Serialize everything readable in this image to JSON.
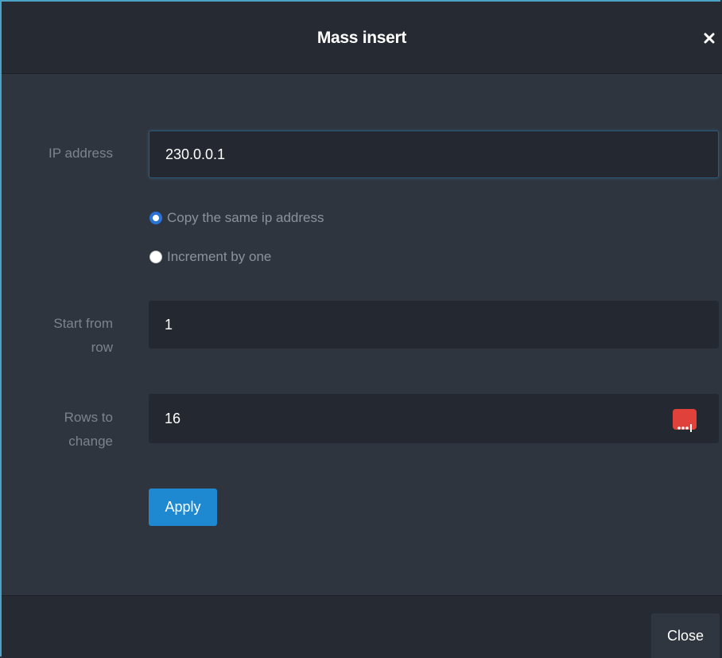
{
  "dialog": {
    "title": "Mass insert",
    "close_icon": "close-icon"
  },
  "ip_address": {
    "label": "IP address",
    "value": "230.0.0.1"
  },
  "mode": {
    "options": [
      {
        "label": "Copy the same ip address",
        "checked": true
      },
      {
        "label": "Increment by one",
        "checked": false
      }
    ]
  },
  "start_row": {
    "label_line1": "Start from",
    "label_line2": "row",
    "value": "1"
  },
  "rows_to_change": {
    "label_line1": "Rows to",
    "label_line2": "change",
    "value": "16",
    "picker_icon": "ellipsis-picker-icon"
  },
  "actions": {
    "apply_label": "Apply",
    "close_label": "Close"
  },
  "colors": {
    "accent": "#1e88d0",
    "picker": "#e0413b",
    "radio_checked": "#2a74d8",
    "frame": "#4aa3c7"
  }
}
